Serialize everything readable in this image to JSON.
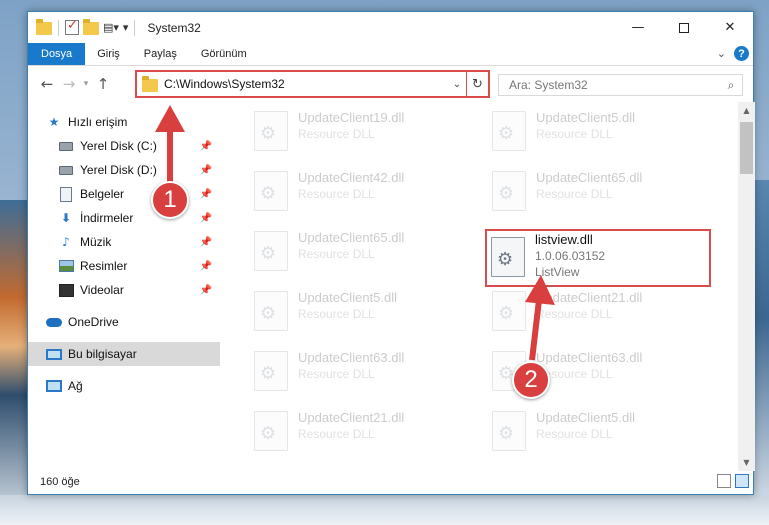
{
  "window": {
    "title": "System32",
    "controls": {
      "minimize": "—",
      "close": "✕"
    }
  },
  "ribbon": {
    "tabs": [
      "Dosya",
      "Giriş",
      "Paylaş",
      "Görünüm"
    ],
    "expand_icon": "chevron-down-icon",
    "help": "?"
  },
  "nav": {
    "address": "C:\\Windows\\System32",
    "search_placeholder": "Ara: System32"
  },
  "sidebar": {
    "items": [
      {
        "label": "Hızlı erişim",
        "icon": "star-icon",
        "pinned": false
      },
      {
        "label": "Yerel Disk (C:)",
        "icon": "drive-icon",
        "pinned": true
      },
      {
        "label": "Yerel Disk (D:)",
        "icon": "drive-icon",
        "pinned": true
      },
      {
        "label": "Belgeler",
        "icon": "documents-icon",
        "pinned": true
      },
      {
        "label": "İndirmeler",
        "icon": "downloads-icon",
        "pinned": true
      },
      {
        "label": "Müzik",
        "icon": "music-icon",
        "pinned": true
      },
      {
        "label": "Resimler",
        "icon": "pictures-icon",
        "pinned": true
      },
      {
        "label": "Videolar",
        "icon": "videos-icon",
        "pinned": true
      },
      {
        "label": "OneDrive",
        "icon": "onedrive-icon",
        "pinned": false
      },
      {
        "label": "Bu bilgisayar",
        "icon": "this-pc-icon",
        "pinned": false,
        "selected": true
      },
      {
        "label": "Ağ",
        "icon": "network-icon",
        "pinned": false
      }
    ]
  },
  "files": {
    "left_column": [
      {
        "name": "UpdateClient19.dll",
        "desc": "Resource DLL"
      },
      {
        "name": "UpdateClient42.dll",
        "desc": "Resource DLL"
      },
      {
        "name": "UpdateClient65.dll",
        "desc": "Resource DLL"
      },
      {
        "name": "UpdateClient5.dll",
        "desc": "Resource DLL"
      },
      {
        "name": "UpdateClient63.dll",
        "desc": "Resource DLL"
      },
      {
        "name": "UpdateClient21.dll",
        "desc": "Resource DLL"
      }
    ],
    "right_column": [
      {
        "name": "UpdateClient5.dll",
        "desc": "Resource DLL"
      },
      {
        "name": "UpdateClient65.dll",
        "desc": "Resource DLL"
      },
      {
        "name": "listview.dll",
        "version": "1.0.06.03152",
        "desc": "ListView",
        "highlighted": true
      },
      {
        "name": "UpdateClient21.dll",
        "desc": "Resource DLL"
      },
      {
        "name": "UpdateClient63.dll",
        "desc": "Resource DLL"
      },
      {
        "name": "UpdateClient5.dll",
        "desc": "Resource DLL"
      }
    ]
  },
  "status": {
    "item_count": "160 öğe"
  },
  "annotations": {
    "step1": "1",
    "step2": "2",
    "color": "#d93f3f"
  }
}
